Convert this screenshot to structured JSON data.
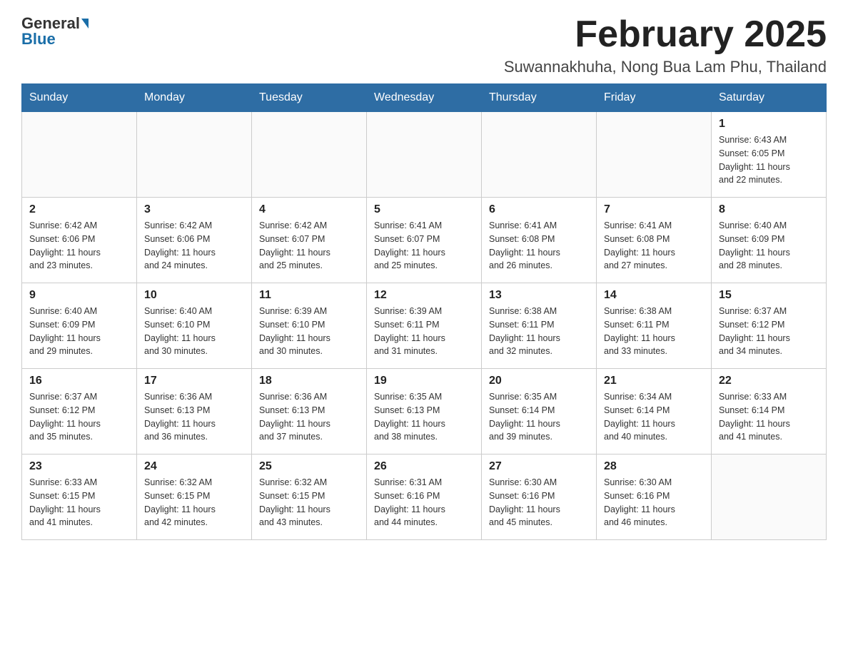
{
  "header": {
    "logo_general": "General",
    "logo_blue": "Blue",
    "title": "February 2025",
    "subtitle": "Suwannakhuha, Nong Bua Lam Phu, Thailand"
  },
  "days_of_week": [
    "Sunday",
    "Monday",
    "Tuesday",
    "Wednesday",
    "Thursday",
    "Friday",
    "Saturday"
  ],
  "weeks": [
    {
      "days": [
        {
          "num": "",
          "info": ""
        },
        {
          "num": "",
          "info": ""
        },
        {
          "num": "",
          "info": ""
        },
        {
          "num": "",
          "info": ""
        },
        {
          "num": "",
          "info": ""
        },
        {
          "num": "",
          "info": ""
        },
        {
          "num": "1",
          "info": "Sunrise: 6:43 AM\nSunset: 6:05 PM\nDaylight: 11 hours\nand 22 minutes."
        }
      ]
    },
    {
      "days": [
        {
          "num": "2",
          "info": "Sunrise: 6:42 AM\nSunset: 6:06 PM\nDaylight: 11 hours\nand 23 minutes."
        },
        {
          "num": "3",
          "info": "Sunrise: 6:42 AM\nSunset: 6:06 PM\nDaylight: 11 hours\nand 24 minutes."
        },
        {
          "num": "4",
          "info": "Sunrise: 6:42 AM\nSunset: 6:07 PM\nDaylight: 11 hours\nand 25 minutes."
        },
        {
          "num": "5",
          "info": "Sunrise: 6:41 AM\nSunset: 6:07 PM\nDaylight: 11 hours\nand 25 minutes."
        },
        {
          "num": "6",
          "info": "Sunrise: 6:41 AM\nSunset: 6:08 PM\nDaylight: 11 hours\nand 26 minutes."
        },
        {
          "num": "7",
          "info": "Sunrise: 6:41 AM\nSunset: 6:08 PM\nDaylight: 11 hours\nand 27 minutes."
        },
        {
          "num": "8",
          "info": "Sunrise: 6:40 AM\nSunset: 6:09 PM\nDaylight: 11 hours\nand 28 minutes."
        }
      ]
    },
    {
      "days": [
        {
          "num": "9",
          "info": "Sunrise: 6:40 AM\nSunset: 6:09 PM\nDaylight: 11 hours\nand 29 minutes."
        },
        {
          "num": "10",
          "info": "Sunrise: 6:40 AM\nSunset: 6:10 PM\nDaylight: 11 hours\nand 30 minutes."
        },
        {
          "num": "11",
          "info": "Sunrise: 6:39 AM\nSunset: 6:10 PM\nDaylight: 11 hours\nand 30 minutes."
        },
        {
          "num": "12",
          "info": "Sunrise: 6:39 AM\nSunset: 6:11 PM\nDaylight: 11 hours\nand 31 minutes."
        },
        {
          "num": "13",
          "info": "Sunrise: 6:38 AM\nSunset: 6:11 PM\nDaylight: 11 hours\nand 32 minutes."
        },
        {
          "num": "14",
          "info": "Sunrise: 6:38 AM\nSunset: 6:11 PM\nDaylight: 11 hours\nand 33 minutes."
        },
        {
          "num": "15",
          "info": "Sunrise: 6:37 AM\nSunset: 6:12 PM\nDaylight: 11 hours\nand 34 minutes."
        }
      ]
    },
    {
      "days": [
        {
          "num": "16",
          "info": "Sunrise: 6:37 AM\nSunset: 6:12 PM\nDaylight: 11 hours\nand 35 minutes."
        },
        {
          "num": "17",
          "info": "Sunrise: 6:36 AM\nSunset: 6:13 PM\nDaylight: 11 hours\nand 36 minutes."
        },
        {
          "num": "18",
          "info": "Sunrise: 6:36 AM\nSunset: 6:13 PM\nDaylight: 11 hours\nand 37 minutes."
        },
        {
          "num": "19",
          "info": "Sunrise: 6:35 AM\nSunset: 6:13 PM\nDaylight: 11 hours\nand 38 minutes."
        },
        {
          "num": "20",
          "info": "Sunrise: 6:35 AM\nSunset: 6:14 PM\nDaylight: 11 hours\nand 39 minutes."
        },
        {
          "num": "21",
          "info": "Sunrise: 6:34 AM\nSunset: 6:14 PM\nDaylight: 11 hours\nand 40 minutes."
        },
        {
          "num": "22",
          "info": "Sunrise: 6:33 AM\nSunset: 6:14 PM\nDaylight: 11 hours\nand 41 minutes."
        }
      ]
    },
    {
      "days": [
        {
          "num": "23",
          "info": "Sunrise: 6:33 AM\nSunset: 6:15 PM\nDaylight: 11 hours\nand 41 minutes."
        },
        {
          "num": "24",
          "info": "Sunrise: 6:32 AM\nSunset: 6:15 PM\nDaylight: 11 hours\nand 42 minutes."
        },
        {
          "num": "25",
          "info": "Sunrise: 6:32 AM\nSunset: 6:15 PM\nDaylight: 11 hours\nand 43 minutes."
        },
        {
          "num": "26",
          "info": "Sunrise: 6:31 AM\nSunset: 6:16 PM\nDaylight: 11 hours\nand 44 minutes."
        },
        {
          "num": "27",
          "info": "Sunrise: 6:30 AM\nSunset: 6:16 PM\nDaylight: 11 hours\nand 45 minutes."
        },
        {
          "num": "28",
          "info": "Sunrise: 6:30 AM\nSunset: 6:16 PM\nDaylight: 11 hours\nand 46 minutes."
        },
        {
          "num": "",
          "info": ""
        }
      ]
    }
  ]
}
